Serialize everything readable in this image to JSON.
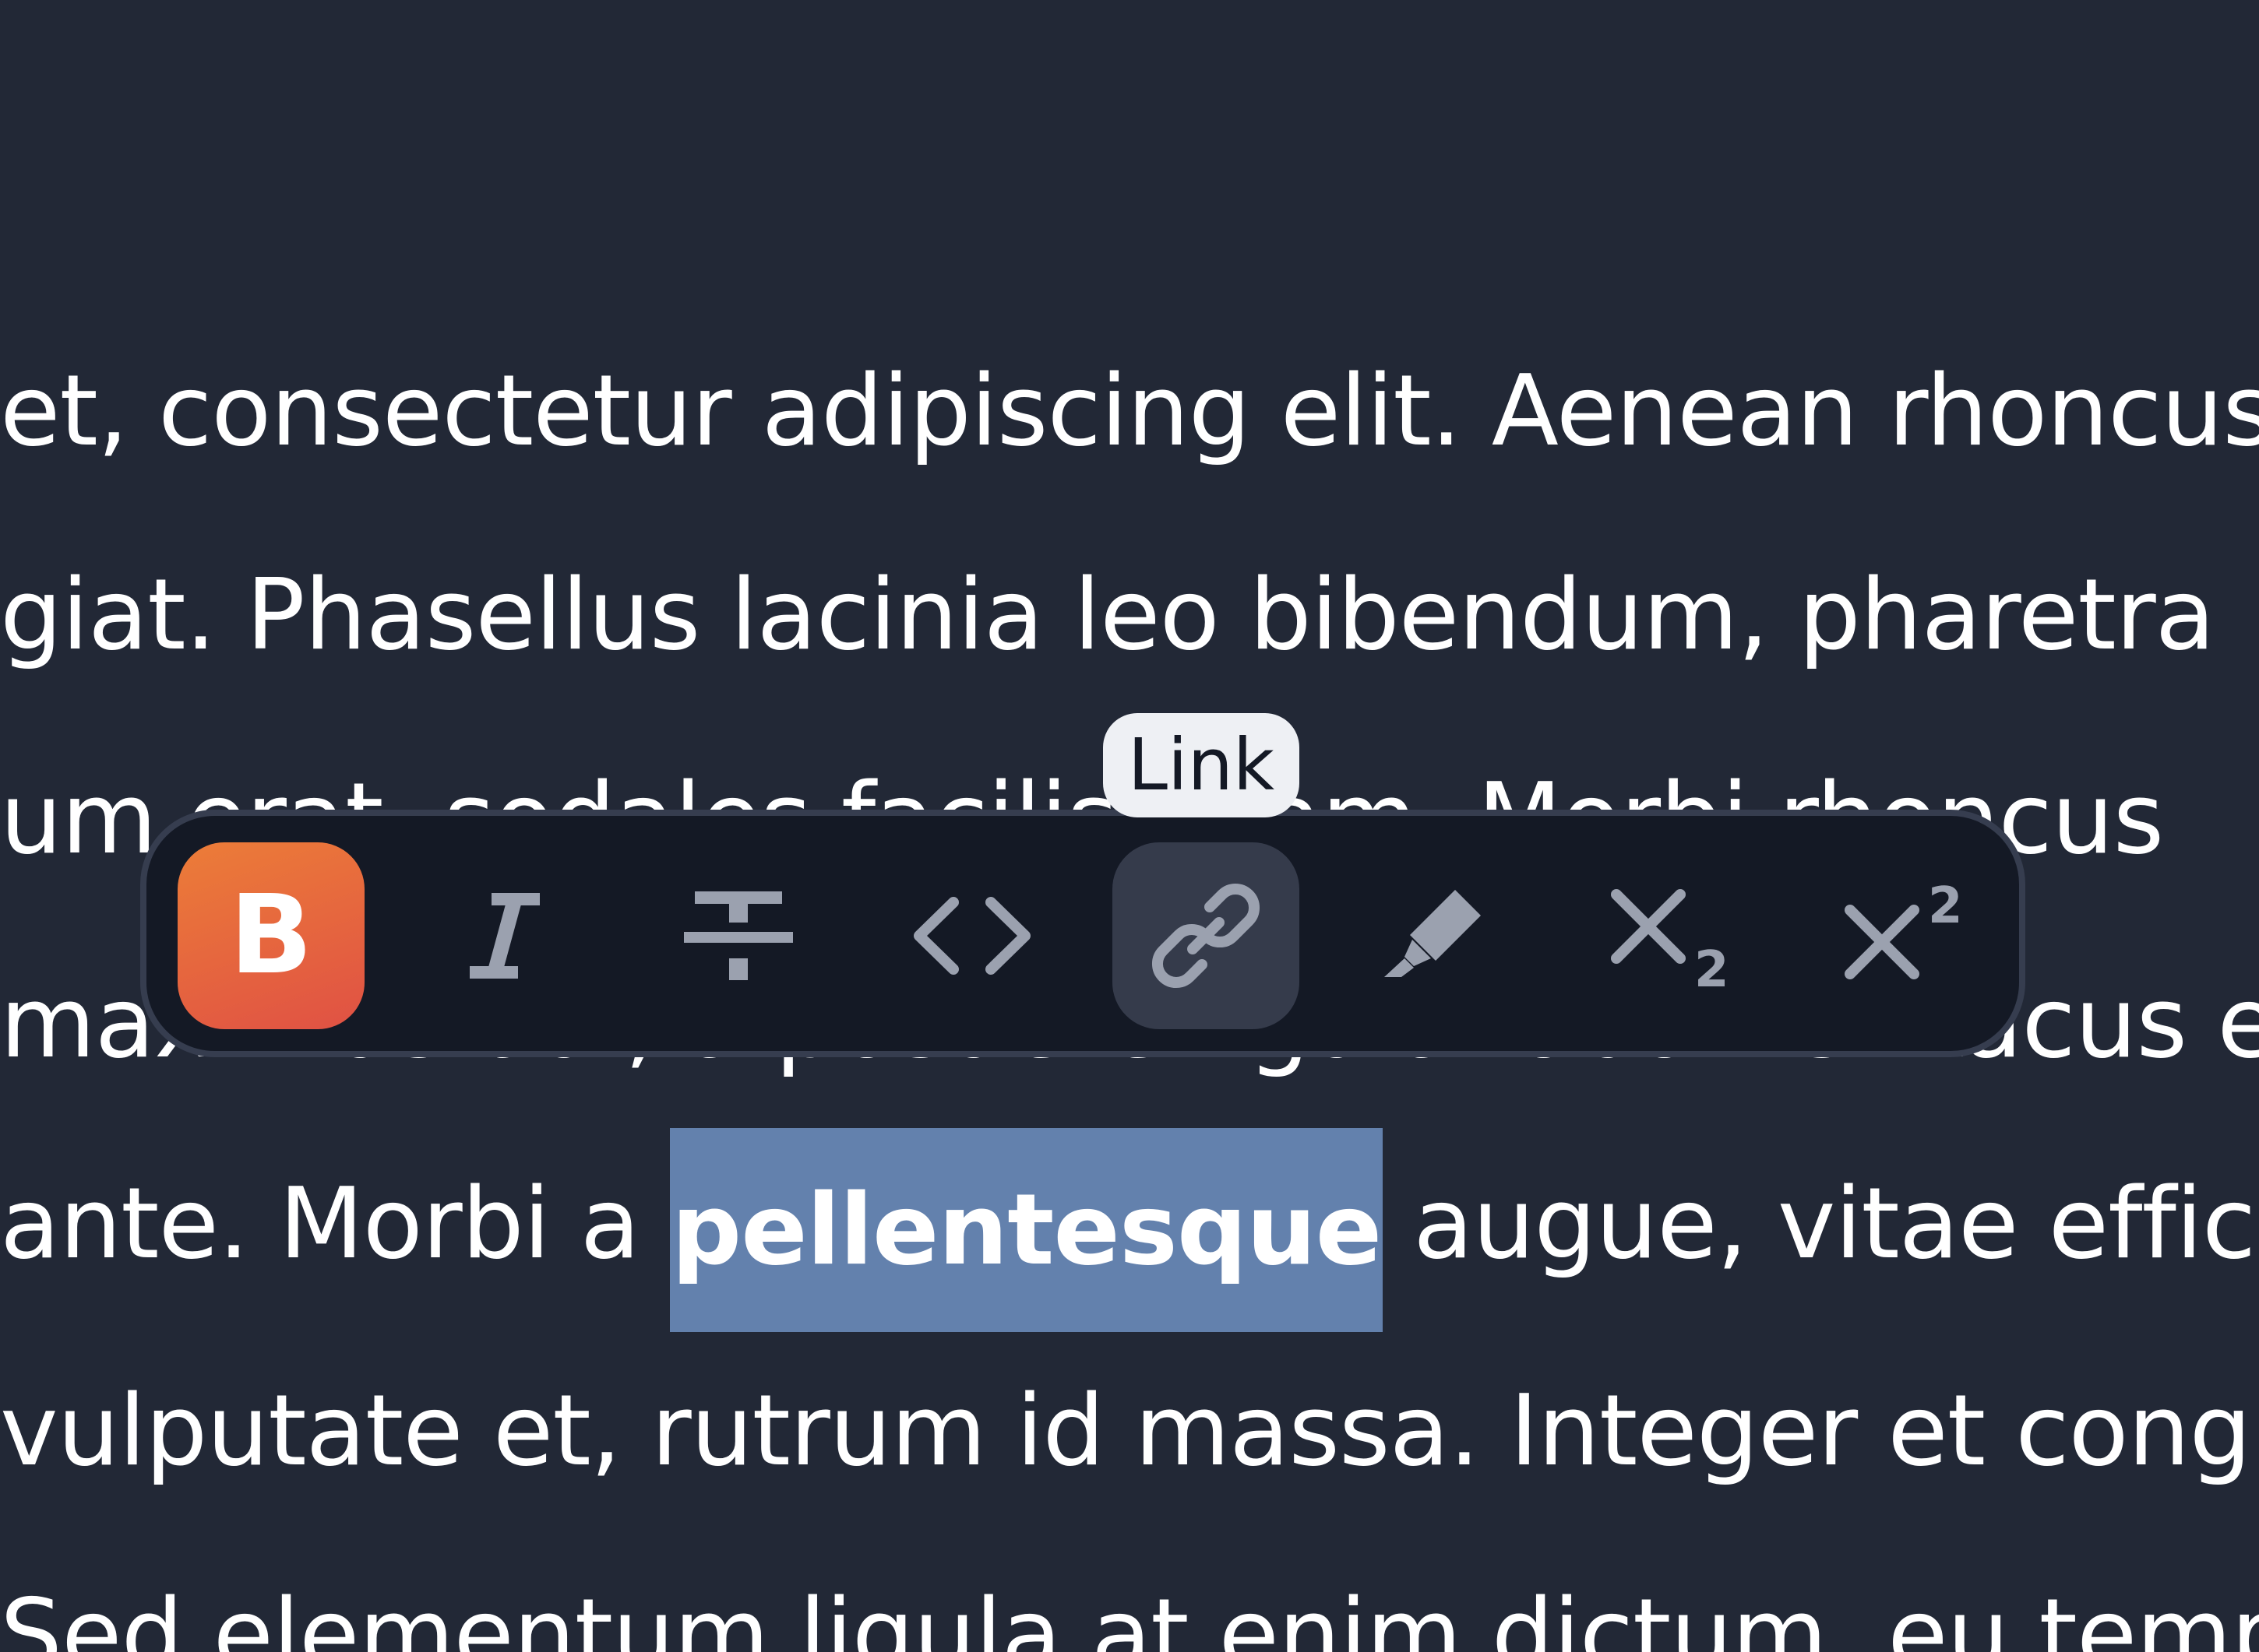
{
  "editor": {
    "lines": [
      "et, consectetur adipiscing elit. Aenean rhoncus",
      "giat. Phasellus lacinia leo bibendum, pharetra",
      "um erat, sodales facilisi diam. Morbi rhoncus",
      "maximus dui, a posuere ligula lobortis. Lacus eget",
      "vulputate et, rutrum id massa. Integer et congue",
      "Sed elementum ligula at enim dictum, eu tempor"
    ],
    "selection_line": {
      "before": " ante. Morbi a ",
      "selected": "pellentesque",
      "after": " augue, vitae efficitur"
    }
  },
  "toolbar": {
    "buttons": [
      {
        "name": "bold",
        "label": "B",
        "active": true
      },
      {
        "name": "italic"
      },
      {
        "name": "strikethrough"
      },
      {
        "name": "code"
      },
      {
        "name": "link",
        "hovered": true
      },
      {
        "name": "highlight"
      },
      {
        "name": "subscript"
      },
      {
        "name": "superscript"
      }
    ],
    "tooltip": "Link"
  },
  "colors": {
    "background": "#222836",
    "toolbar_bg": "#141925",
    "toolbar_border": "#363d4f",
    "icon": "#9ba1af",
    "bold_gradient_start": "#ec7d38",
    "bold_gradient_end": "#e05144",
    "selection": "#6381ad",
    "hover": "#353b4b"
  }
}
